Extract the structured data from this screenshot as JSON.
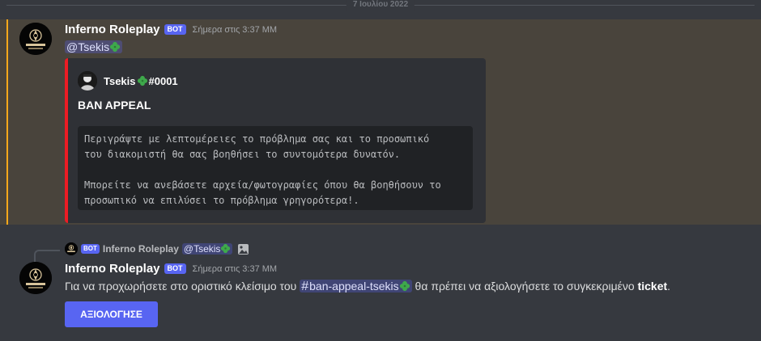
{
  "date_divider": "7 Ιουλίου 2022",
  "message1": {
    "author": "Inferno Roleplay",
    "bot_tag": "BOT",
    "timestamp": "Σήμερα στις 3:37 MM",
    "mention": "@Tsekis",
    "embed": {
      "author_name": "Tsekis",
      "author_discriminator": "#0001",
      "title": "BAN APPEAL",
      "code_lines": [
        "Περιγράψτε με λεπτομέρειες το πρόβλημα σας και το προσωπικό",
        "του διακομιστή θα σας βοηθήσει το συντομότερα δυνατόν.",
        "",
        "Μπορείτε να ανεβάσετε αρχεία/φωτογραφίες όπου θα βοηθήσουν το",
        "προσωπικό να επιλύσει το πρόβλημα γρηγορότερα!."
      ],
      "accent_color": "#ed1c24"
    }
  },
  "message2": {
    "reply": {
      "bot_tag": "BOT",
      "author": "Inferno Roleplay",
      "mention": "@Tsekis"
    },
    "author": "Inferno Roleplay",
    "bot_tag": "BOT",
    "timestamp": "Σήμερα στις 3:37 MM",
    "text_before": "Για να προχωρήσετε στο οριστικό κλείσιμο του",
    "channel_hash": "#",
    "channel_name": "ban-appeal-tsekis",
    "text_after": "θα πρέπει να αξιολογήσετε το συγκεκριμένο",
    "bold_word": "ticket",
    "text_end": ".",
    "button_label": "ΑΞΙΟΛΟΓΗΣΕ"
  },
  "colors": {
    "background": "#36393f",
    "highlight_background": "#49443c",
    "highlight_bar": "#faa81a",
    "blurple": "#5865f2"
  },
  "icons": [
    "inferno-logo-icon",
    "clover-icon",
    "image-icon",
    "user-avatar-icon"
  ]
}
